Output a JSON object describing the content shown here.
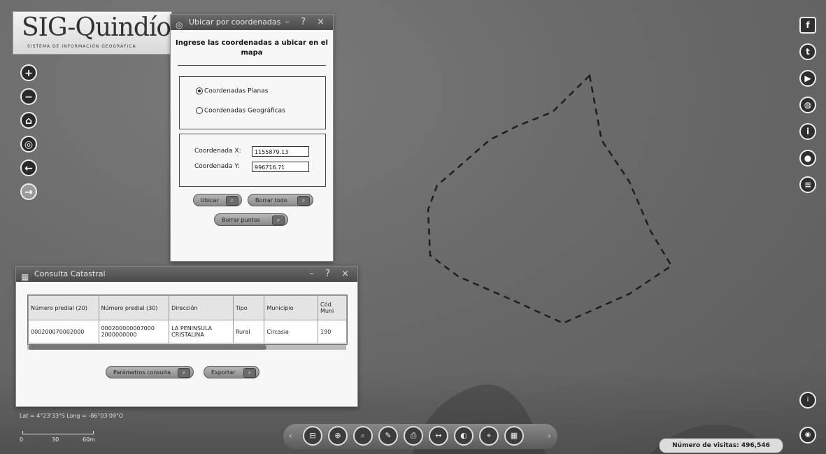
{
  "app": {
    "logo_title": "SIG-Quindío",
    "logo_subtitle": "SISTEMA DE INFORMACIÓN GEOGRÁFICA"
  },
  "coord_window": {
    "title": "Ubicar por coordenadas",
    "controls": "– ? ×",
    "heading": "Ingrese las coordenadas a ubicar en el mapa",
    "radio_planas": "Coordenadas Planas",
    "radio_geograficas": "Coordenadas Geográficas",
    "x_label": "Coordenada X:",
    "x_value": "1155879.13",
    "y_label": "Coordenada Y:",
    "y_value": "996716.71",
    "btn_ubicar": "Ubicar",
    "btn_borrar_todo": "Borrar todo",
    "btn_borrar_puntos": "Borrar puntos"
  },
  "catastral_window": {
    "title": "Consulta Catastral",
    "controls": "– ? ×",
    "columns": [
      "Número predial (20)",
      "Número predial (30)",
      "Dirección",
      "Tipo",
      "Municipio",
      "Cód. Muni"
    ],
    "rows": [
      [
        "000200070002000",
        "000200000007000 2000000000",
        "LA PENINSULA CRISTALINA",
        "Rural",
        "Circasia",
        "190"
      ]
    ],
    "btn_parametros": "Parámetros consulta",
    "btn_exportar": "Exportar"
  },
  "status": {
    "coords": "Lat = 4°23'33\"S Long = -86°03'09\"O",
    "scale_labels": [
      "0",
      "30",
      "60m"
    ],
    "visits_label": "Número de visitas:",
    "visits_value": "496,546"
  }
}
